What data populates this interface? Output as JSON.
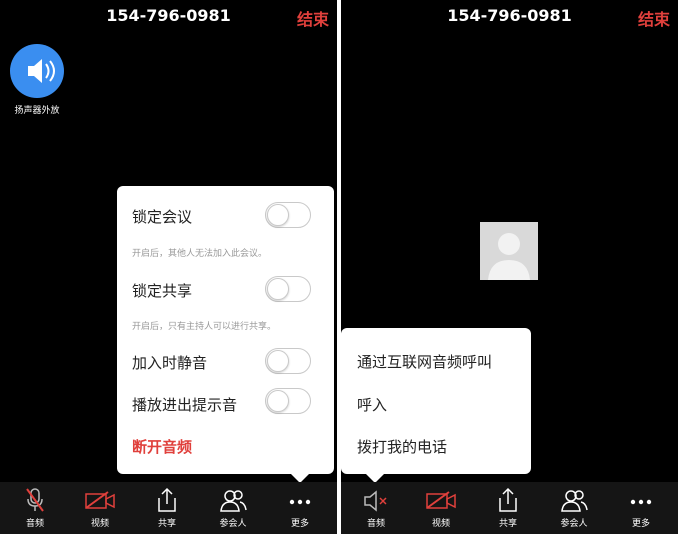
{
  "left_screen": {
    "header": {
      "phone_number": "154-796-0981",
      "end_label": "结束"
    },
    "speaker": {
      "label": "扬声器外放",
      "icon": "speaker-icon"
    },
    "settings_popup": {
      "lock_meeting": {
        "label": "锁定会议",
        "hint": "开启后，其他人无法加入此会议。",
        "enabled": false
      },
      "lock_share": {
        "label": "锁定共享",
        "hint": "开启后，只有主持人可以进行共享。",
        "enabled": false
      },
      "mute_on_join": {
        "label": "加入时静音",
        "enabled": false
      },
      "play_join_leave_sound": {
        "label": "播放进出提示音",
        "enabled": false
      },
      "disconnect_audio": "断开音频"
    },
    "toolbar": [
      {
        "key": "audio",
        "label": "音频",
        "icon": "mic-muted-icon"
      },
      {
        "key": "video",
        "label": "视频",
        "icon": "camera-off-icon"
      },
      {
        "key": "share",
        "label": "共享",
        "icon": "share-icon"
      },
      {
        "key": "participants",
        "label": "参会人",
        "icon": "participants-icon"
      },
      {
        "key": "more",
        "label": "更多",
        "icon": "more-icon"
      }
    ]
  },
  "right_screen": {
    "header": {
      "phone_number": "154-796-0981",
      "end_label": "结束"
    },
    "audio_menu": [
      "通过互联网音频呼叫",
      "呼入",
      "拨打我的电话"
    ],
    "toolbar": [
      {
        "key": "audio",
        "label": "音频",
        "icon": "speaker-off-icon"
      },
      {
        "key": "video",
        "label": "视频",
        "icon": "camera-off-icon"
      },
      {
        "key": "share",
        "label": "共享",
        "icon": "share-icon"
      },
      {
        "key": "participants",
        "label": "参会人",
        "icon": "participants-icon"
      },
      {
        "key": "more",
        "label": "更多",
        "icon": "more-icon"
      }
    ]
  },
  "colors": {
    "accent_red": "#e0403c",
    "speaker_blue": "#3a8ef0",
    "background": "#000000"
  }
}
